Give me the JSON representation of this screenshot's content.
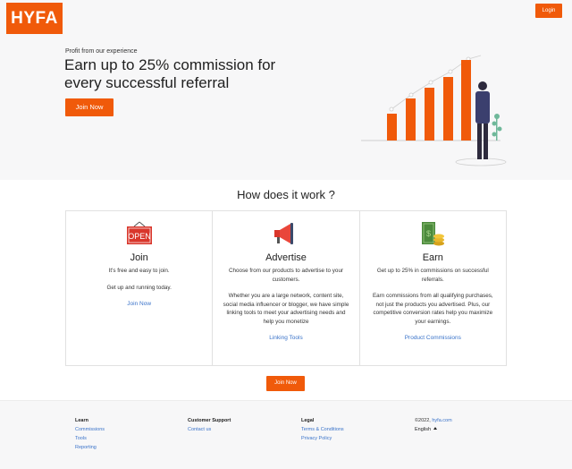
{
  "header": {
    "logo": "HYFA",
    "login_label": "Login"
  },
  "hero": {
    "subtitle": "Profit from our experience",
    "title": "Earn up to 25% commission for every successful referral",
    "cta_label": "Join Now"
  },
  "how": {
    "title": "How does it work ?",
    "cards": [
      {
        "title": "Join",
        "sign_text": "OPEN",
        "text1": "It's free and easy to join.",
        "text2": "Get up and running today.",
        "link": "Join Now"
      },
      {
        "title": "Advertise",
        "text1": "Choose from our products to advertise to your customers.",
        "text2": "Whether you are a large network, content site, social media influencer or blogger, we have simple linking tools to meet your advertising needs and help you monetize",
        "link": "Linking Tools"
      },
      {
        "title": "Earn",
        "text1": "Get up to 25% in commissions on successful referrals.",
        "text2": "Earn commissions from all qualifying purchases, not just the products you advertised. Plus, our competitive conversion rates help you maximize your earnings.",
        "link": "Product Commissions"
      }
    ],
    "cta_label": "Join Now"
  },
  "footer": {
    "learn": {
      "heading": "Learn",
      "links": [
        "Commissions",
        "Tools",
        "Reporting"
      ]
    },
    "support": {
      "heading": "Customer Support",
      "links": [
        "Contact us"
      ]
    },
    "legal": {
      "heading": "Legal",
      "links": [
        "Terms & Conditions",
        "Privacy Policy"
      ]
    },
    "meta": {
      "copyright": "©2022,",
      "site": "hyfa.com",
      "language": "English"
    }
  },
  "colors": {
    "accent": "#f05a0a",
    "link": "#3a73c9",
    "hero_bg": "#f7f7f8"
  },
  "icons": [
    "open-sign-icon",
    "megaphone-icon",
    "money-icon",
    "chevron-up-icon"
  ]
}
